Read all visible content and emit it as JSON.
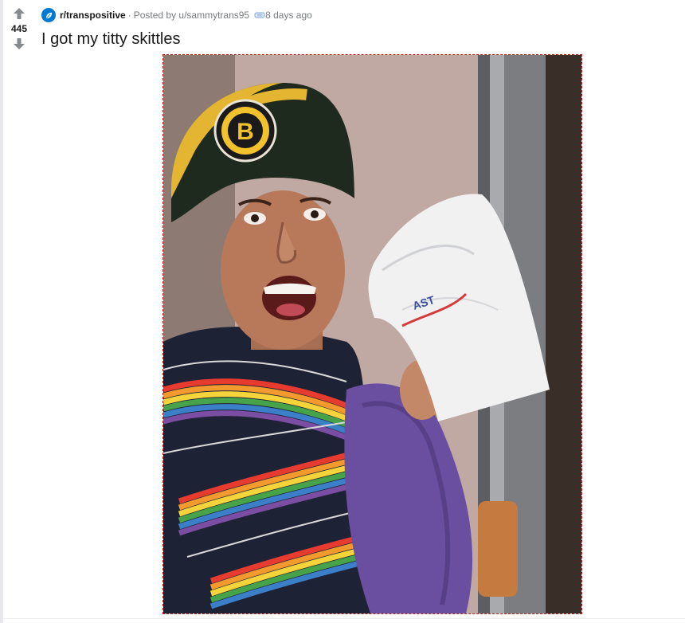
{
  "post": {
    "score": "445",
    "subreddit": "r/transpositive",
    "posted_by": "Posted by u/sammytrans95",
    "age": "8 days ago",
    "title": "I got my titty skittles"
  },
  "image": {
    "bag_text": "AST"
  },
  "icons": {
    "upvote": "upvote-arrow-icon",
    "downvote": "downvote-arrow-icon",
    "subreddit": "subreddit-avatar-icon",
    "award": "award-icon"
  },
  "colors": {
    "vote_arrow": "#878a8c",
    "subreddit_icon": "#0079d3",
    "text_primary": "#1a1a1b",
    "text_meta": "#787c7e",
    "image_border": "#c02020"
  }
}
